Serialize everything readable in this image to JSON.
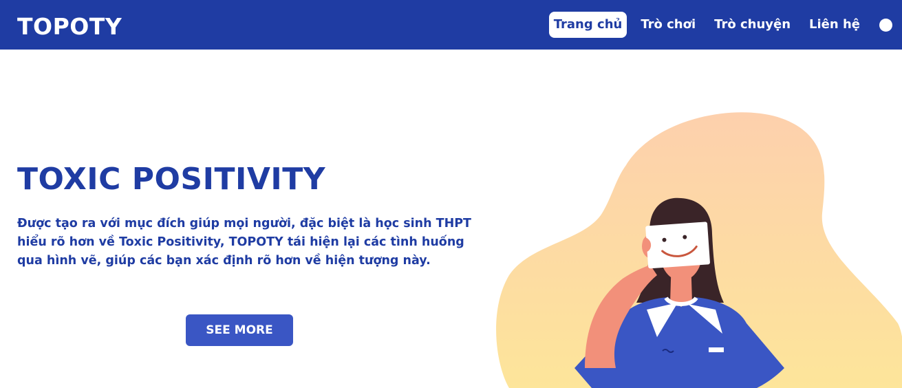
{
  "header": {
    "logo": "TOPOTY",
    "nav": [
      {
        "label": "Trang chủ",
        "active": true
      },
      {
        "label": "Trò chơi",
        "active": false
      },
      {
        "label": "Trò chuyện",
        "active": false
      },
      {
        "label": "Liên hệ",
        "active": false
      }
    ],
    "profile_icon": "circle-dot-icon"
  },
  "hero": {
    "title": "TOXIC POSITIVITY",
    "description": "Được tạo ra với mục đích giúp mọi người, đặc biệt là học sinh THPT hiểu rõ hơn về Toxic Positivity, TOPOTY tái hiện lại các tình huống qua hình vẽ, giúp các bạn xác định rõ hơn về hiện tượng này.",
    "cta_label": "SEE MORE",
    "illustration_icon": "girl-holding-smiley-mask-illustration"
  },
  "colors": {
    "brand_blue": "#1f3ca3",
    "button_blue": "#3a56c4",
    "blob_peach": "#fdd3ae",
    "blob_yellow": "#fde49a",
    "shirt_blue": "#3a56c4",
    "skin": "#f2907a"
  }
}
